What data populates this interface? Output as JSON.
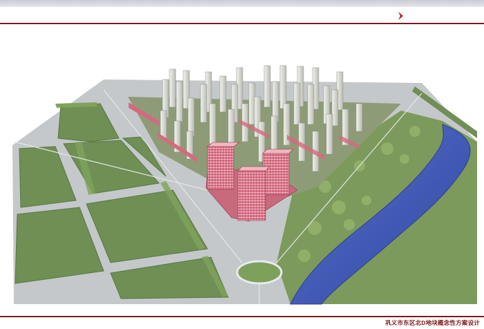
{
  "slide": {
    "footer_caption": "巩义市东区北D地块概念性方案设计",
    "nav_icon": "chevron-right-icon",
    "colors": {
      "accent": "#7a1b1b",
      "arrow": "#b31b1b",
      "road": "#bfc3c6",
      "grass": "#6f8f52",
      "river": "#3b55b5",
      "tower": "#e2e4de",
      "commercial": "#d56a7e"
    }
  }
}
